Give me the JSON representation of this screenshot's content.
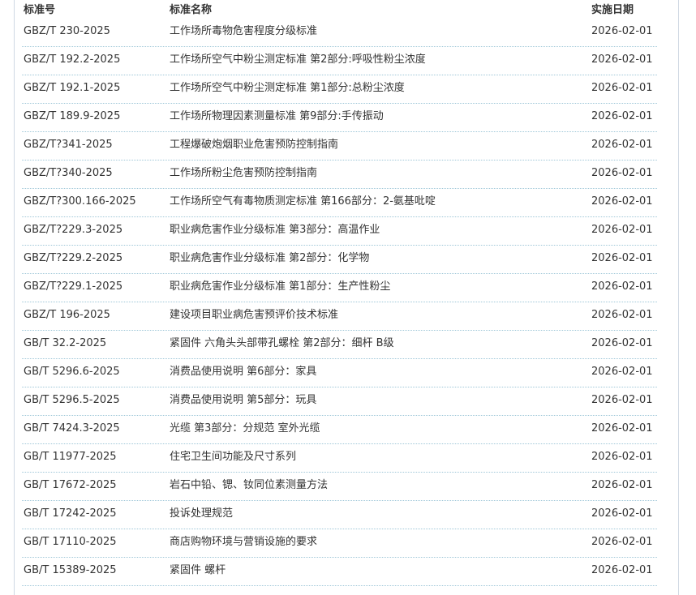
{
  "table": {
    "headers": {
      "code": "标准号",
      "name": "标准名称",
      "date": "实施日期"
    },
    "rows": [
      {
        "code": "GBZ/T 230-2025",
        "name": "工作场所毒物危害程度分级标准",
        "date": "2026-02-01"
      },
      {
        "code": "GBZ/T 192.2-2025",
        "name": "工作场所空气中粉尘测定标准 第2部分:呼吸性粉尘浓度",
        "date": "2026-02-01"
      },
      {
        "code": "GBZ/T 192.1-2025",
        "name": "工作场所空气中粉尘测定标准 第1部分:总粉尘浓度",
        "date": "2026-02-01"
      },
      {
        "code": "GBZ/T 189.9-2025",
        "name": "工作场所物理因素测量标准 第9部分:手传振动",
        "date": "2026-02-01"
      },
      {
        "code": "GBZ/T?341-2025",
        "name": "工程爆破炮烟职业危害预防控制指南",
        "date": "2026-02-01"
      },
      {
        "code": "GBZ/T?340-2025",
        "name": "工作场所粉尘危害预防控制指南",
        "date": "2026-02-01"
      },
      {
        "code": "GBZ/T?300.166-2025",
        "name": "工作场所空气有毒物质测定标准 第166部分：2-氨基吡啶",
        "date": "2026-02-01"
      },
      {
        "code": "GBZ/T?229.3-2025",
        "name": "职业病危害作业分级标准 第3部分：高温作业",
        "date": "2026-02-01"
      },
      {
        "code": "GBZ/T?229.2-2025",
        "name": "职业病危害作业分级标准 第2部分：化学物",
        "date": "2026-02-01"
      },
      {
        "code": "GBZ/T?229.1-2025",
        "name": "职业病危害作业分级标准 第1部分：生产性粉尘",
        "date": "2026-02-01"
      },
      {
        "code": "GBZ/T 196-2025",
        "name": "建设项目职业病危害预评价技术标准",
        "date": "2026-02-01"
      },
      {
        "code": "GB/T 32.2-2025",
        "name": "紧固件 六角头头部带孔螺栓 第2部分：细杆 B级",
        "date": "2026-02-01"
      },
      {
        "code": "GB/T 5296.6-2025",
        "name": "消费品使用说明 第6部分：家具",
        "date": "2026-02-01"
      },
      {
        "code": "GB/T 5296.5-2025",
        "name": "消费品使用说明 第5部分：玩具",
        "date": "2026-02-01"
      },
      {
        "code": "GB/T 7424.3-2025",
        "name": "光缆 第3部分：分规范 室外光缆",
        "date": "2026-02-01"
      },
      {
        "code": "GB/T 11977-2025",
        "name": "住宅卫生间功能及尺寸系列",
        "date": "2026-02-01"
      },
      {
        "code": "GB/T 17672-2025",
        "name": "岩石中铅、锶、钕同位素测量方法",
        "date": "2026-02-01"
      },
      {
        "code": "GB/T 17242-2025",
        "name": "投诉处理规范",
        "date": "2026-02-01"
      },
      {
        "code": "GB/T 17110-2025",
        "name": "商店购物环境与营销设施的要求",
        "date": "2026-02-01"
      },
      {
        "code": "GB/T 15389-2025",
        "name": "紧固件 螺杆",
        "date": "2026-02-01"
      }
    ]
  }
}
